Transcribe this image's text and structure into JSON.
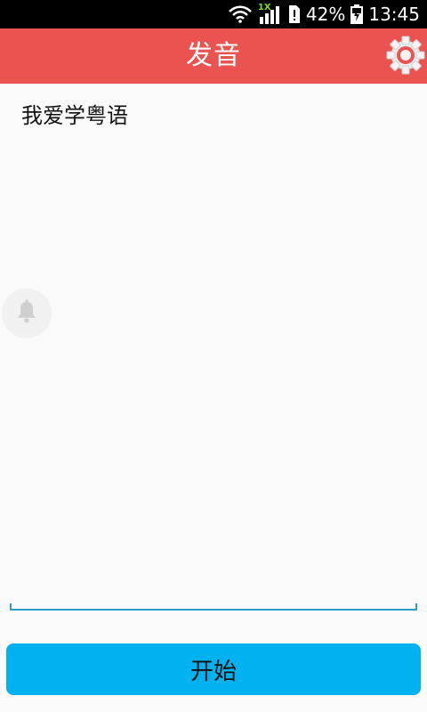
{
  "status_bar": {
    "battery_percent": "42%",
    "time": "13:45",
    "network_badge": "1X",
    "icons": [
      "wifi-icon",
      "signal-icon",
      "sim-alert-icon",
      "battery-charging-icon"
    ]
  },
  "header": {
    "title": "发音",
    "settings_icon": "gear-icon",
    "accent_color": "#ea5350"
  },
  "editor": {
    "value": "我爱学粤语"
  },
  "floating_action": {
    "icon": "bell-icon"
  },
  "actions": {
    "start_label": "开始",
    "start_color": "#00b2f0"
  }
}
